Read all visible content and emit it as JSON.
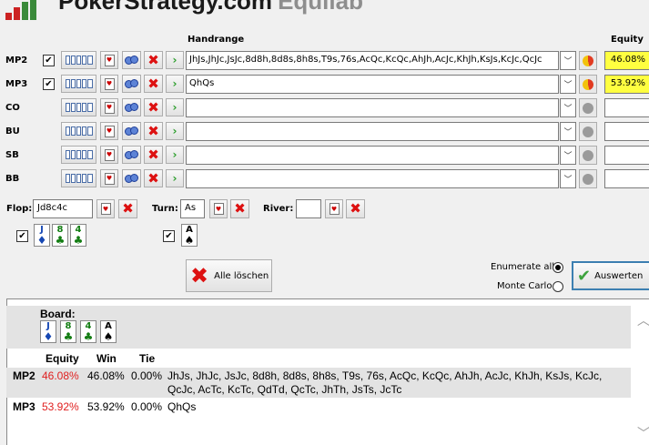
{
  "app": {
    "title_main": "PokerStrategy.com",
    "title_sub": "Equilab"
  },
  "headers": {
    "handrange": "Handrange",
    "equity": "Equity"
  },
  "players": [
    {
      "pos": "MP2",
      "checked": true,
      "range": "JhJs,JhJc,JsJc,8d8h,8d8s,8h8s,T9s,76s,AcQc,KcQc,AhJh,AcJc,KhJh,KsJs,KcJc,QcJc",
      "equity": "46.08%",
      "pie": true
    },
    {
      "pos": "MP3",
      "checked": true,
      "range": "QhQs",
      "equity": "53.92%",
      "pie": true
    },
    {
      "pos": "CO",
      "checked": false,
      "range": "",
      "equity": "",
      "pie": false
    },
    {
      "pos": "BU",
      "checked": false,
      "range": "",
      "equity": "",
      "pie": false
    },
    {
      "pos": "SB",
      "checked": false,
      "range": "",
      "equity": "",
      "pie": false
    },
    {
      "pos": "BB",
      "checked": false,
      "range": "",
      "equity": "",
      "pie": false
    }
  ],
  "board": {
    "flop_label": "Flop:",
    "flop_value": "Jd8c4c",
    "turn_label": "Turn:",
    "turn_value": "As",
    "river_label": "River:",
    "river_value": "",
    "flop_cards": [
      {
        "rank": "J",
        "suit": "♦",
        "cls": "d"
      },
      {
        "rank": "8",
        "suit": "♣",
        "cls": "c"
      },
      {
        "rank": "4",
        "suit": "♣",
        "cls": "c"
      }
    ],
    "turn_cards": [
      {
        "rank": "A",
        "suit": "♠",
        "cls": "s"
      }
    ]
  },
  "actions": {
    "clear_all": "Alle löschen",
    "enumerate_all": "Enumerate all",
    "monte_carlo": "Monte Carlo",
    "evaluate": "Auswerten"
  },
  "results": {
    "board_label": "Board:",
    "board_cards": [
      {
        "rank": "J",
        "suit": "♦",
        "cls": "d"
      },
      {
        "rank": "8",
        "suit": "♣",
        "cls": "c"
      },
      {
        "rank": "4",
        "suit": "♣",
        "cls": "c"
      },
      {
        "rank": "A",
        "suit": "♠",
        "cls": "s"
      }
    ],
    "col_equity": "Equity",
    "col_win": "Win",
    "col_tie": "Tie",
    "rows": [
      {
        "pos": "MP2",
        "equity": "46.08%",
        "win": "46.08%",
        "tie": "0.00%",
        "hands_line1": "JhJs, JhJc, JsJc, 8d8h, 8d8s, 8h8s, T9s, 76s, AcQc, KcQc, AhJh, AcJc, KhJh, KsJs, KcJc,",
        "hands_line2": "QcJc, AcTc, KcTc, QdTd, QcTc, JhTh, JsTs, JcTc"
      },
      {
        "pos": "MP3",
        "equity": "53.92%",
        "win": "53.92%",
        "tie": "0.00%",
        "hands_line1": "QhQs",
        "hands_line2": ""
      }
    ]
  },
  "colors": {
    "equity_highlight": "#ffff40",
    "result_equity": "#e02020"
  }
}
